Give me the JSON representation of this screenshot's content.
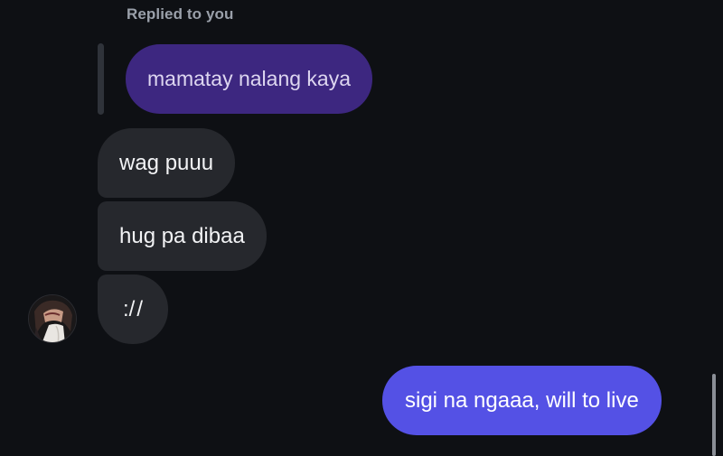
{
  "reply": {
    "label": "Replied to you",
    "quoted_text": "mamatay nalang kaya"
  },
  "messages": {
    "incoming": [
      {
        "text": "wag puuu"
      },
      {
        "text": "hug pa dibaa"
      },
      {
        "text": ":/ /"
      }
    ],
    "outgoing": [
      {
        "text": "sigi na ngaaa, will to live"
      }
    ]
  },
  "colors": {
    "background": "#0e1014",
    "incoming_bubble": "#26282d",
    "quoted_bubble": "#3d2780",
    "outgoing_bubble": "#5451e5",
    "reply_label": "#9aa0aa"
  },
  "icons": {
    "sender_avatar": "profile-photo"
  }
}
